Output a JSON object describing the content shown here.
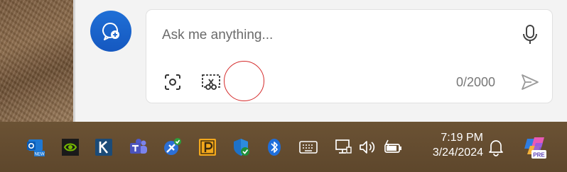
{
  "composer": {
    "placeholder": "Ask me anything...",
    "char_count": "0/2000"
  },
  "taskbar": {
    "time": "7:19 PM",
    "date": "3/24/2024",
    "copilot_badge": "PRE",
    "outlook_badge": "NEW"
  },
  "colors": {
    "accent": "#1a63cc",
    "taskbar": "#614a2f",
    "cursor_ring": "#d42a2a"
  },
  "icons": [
    "new-chat-icon",
    "microphone-icon",
    "screenshot-icon",
    "snip-icon",
    "send-icon",
    "outlook-icon",
    "nvidia-icon",
    "k-app-icon",
    "teams-icon",
    "tools-app-icon",
    "p-app-icon",
    "defender-icon",
    "bluetooth-icon",
    "keyboard-icon",
    "network-icon",
    "volume-icon",
    "battery-icon",
    "notifications-icon",
    "copilot-icon"
  ]
}
